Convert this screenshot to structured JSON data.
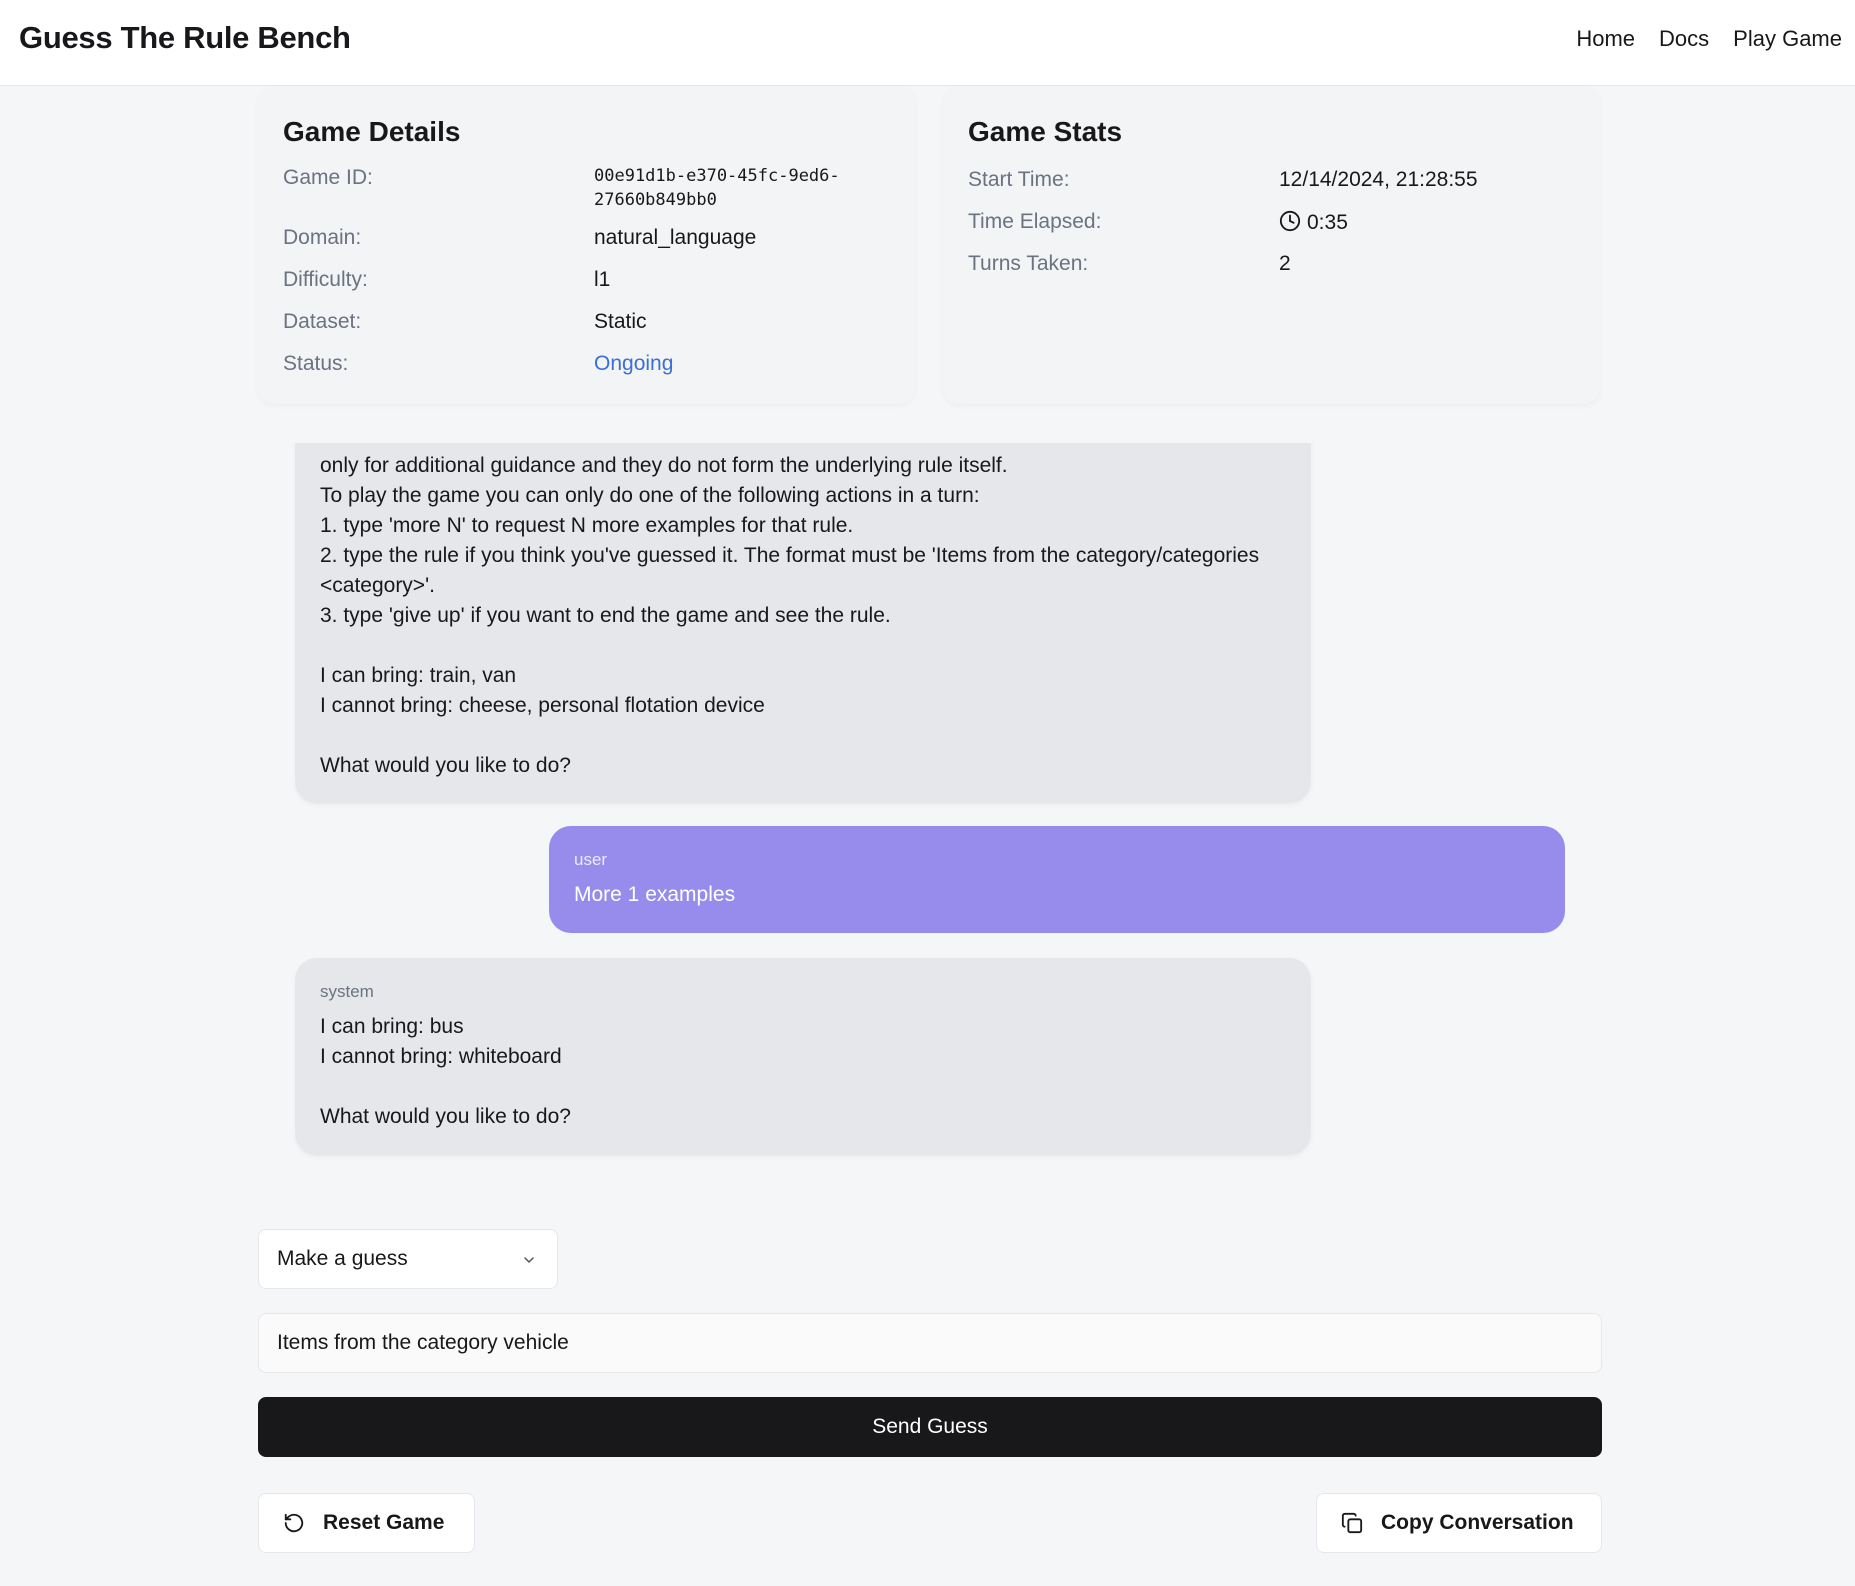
{
  "header": {
    "brand": "Guess The Rule Bench",
    "nav": [
      "Home",
      "Docs",
      "Play Game"
    ]
  },
  "details": {
    "title": "Game Details",
    "rows": [
      {
        "label": "Game ID:",
        "value": "00e91d1b-e370-45fc-9ed6-\n27660b849bb0"
      },
      {
        "label": "Domain:",
        "value": "natural_language"
      },
      {
        "label": "Difficulty:",
        "value": "l1"
      },
      {
        "label": "Dataset:",
        "value": "Static"
      },
      {
        "label": "Status:",
        "value": "Ongoing"
      }
    ]
  },
  "stats": {
    "title": "Game Stats",
    "rows": [
      {
        "label": "Start Time:",
        "value": "12/14/2024, 21:28:55"
      },
      {
        "label": "Time Elapsed:",
        "value": "0:35"
      },
      {
        "label": "Turns Taken:",
        "value": "2"
      }
    ]
  },
  "chat": {
    "messages": [
      {
        "role": "",
        "text": "only for additional guidance and they do not form the underlying rule itself.\nTo play the game you can only do one of the following actions in a turn:\n1. type 'more N' to request N more examples for that rule.\n2. type the rule if you think you've guessed it. The format must be 'Items from the category/categories <category>'.\n3. type 'give up' if you want to end the game and see the rule.\n\nI can bring: train, van\nI cannot bring: cheese, personal flotation device\n\nWhat would you like to do?"
      },
      {
        "role": "user",
        "text": "More 1 examples"
      },
      {
        "role": "system",
        "text": "I can bring: bus\nI cannot bring: whiteboard\n\nWhat would you like to do?"
      }
    ]
  },
  "controls": {
    "action_select": "Make a guess",
    "guess_input": "Items from the category vehicle",
    "send_label": "Send Guess",
    "reset_label": "Reset Game",
    "copy_label": "Copy Conversation"
  }
}
